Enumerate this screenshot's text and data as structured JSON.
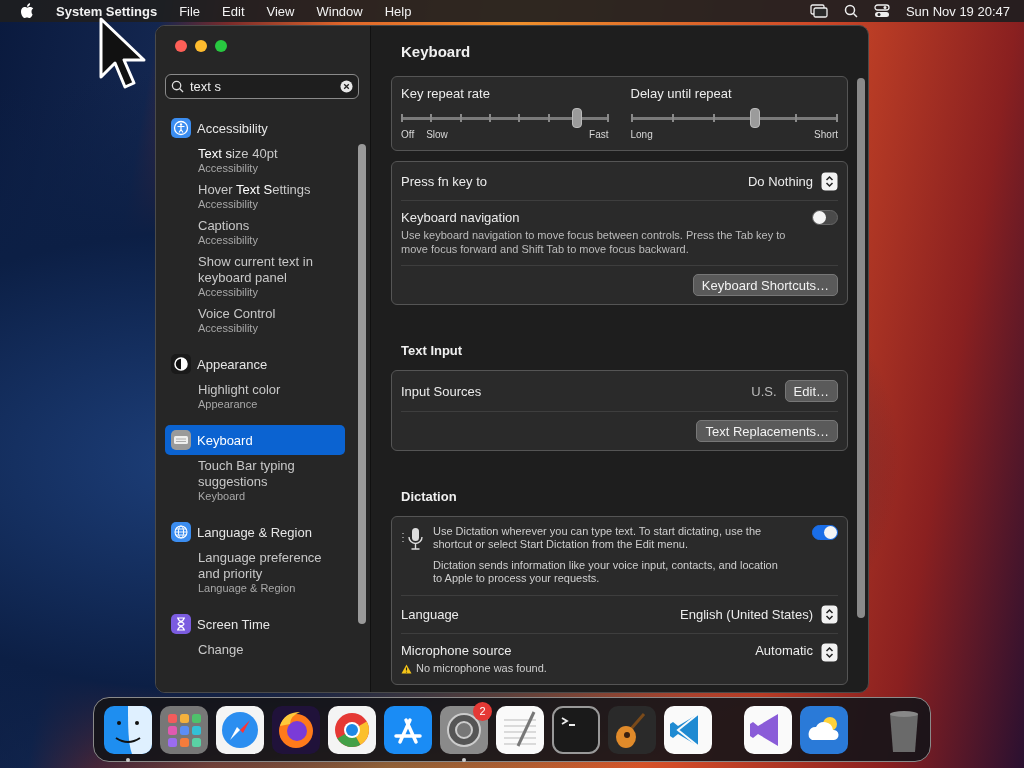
{
  "menu_bar": {
    "app": "System Settings",
    "menus": [
      "File",
      "Edit",
      "View",
      "Window",
      "Help"
    ],
    "clock": "Sun Nov 19  20:47"
  },
  "window": {
    "search": {
      "value": "text s"
    },
    "sidebar": {
      "groups": [
        {
          "kind": "accessibility",
          "label": "Accessibility",
          "color": "#3b8df0",
          "selected": false,
          "results": [
            {
              "title": "**Text s**ize 40pt",
              "subtitle": "Accessibility"
            },
            {
              "title": "Hover **Text S**ettings",
              "subtitle": "Accessibility"
            },
            {
              "title": "Captions",
              "subtitle": "Accessibility"
            },
            {
              "title": "Show current text in keyboard panel",
              "subtitle": "Accessibility"
            },
            {
              "title": "Voice Control",
              "subtitle": "Accessibility"
            }
          ]
        },
        {
          "kind": "appearance",
          "label": "Appearance",
          "color": "#1a1a1a",
          "selected": false,
          "results": [
            {
              "title": "Highlight color",
              "subtitle": "Appearance"
            }
          ]
        },
        {
          "kind": "keyboard",
          "label": "Keyboard",
          "color": "#9a9a9a",
          "selected": true,
          "results": [
            {
              "title": "Touch Bar typing suggestions",
              "subtitle": "Keyboard"
            }
          ]
        },
        {
          "kind": "globe",
          "label": "Language & Region",
          "color": "#3b8df0",
          "selected": false,
          "results": [
            {
              "title": "Language preference and priority",
              "subtitle": "Language & Region"
            }
          ]
        },
        {
          "kind": "hourglass",
          "label": "Screen Time",
          "color": "#7b5ce0",
          "selected": false,
          "results": [
            {
              "title": "Change"
            }
          ]
        }
      ]
    },
    "content": {
      "title": "Keyboard",
      "sections": [
        {
          "cards": [
            {
              "rows": [
                {
                  "kind": "sliders",
                  "sliders": [
                    {
                      "label": "Key repeat rate",
                      "level": 0.85,
                      "scale": [
                        "Off",
                        "Slow",
                        "Fast"
                      ]
                    },
                    {
                      "label": "Delay until repeat",
                      "level": 0.6,
                      "scale": [
                        "Long",
                        "Short"
                      ]
                    }
                  ]
                }
              ]
            },
            {
              "rows": [
                {
                  "kind": "popup",
                  "label": "Press fn key to",
                  "value": "Do Nothing"
                },
                {
                  "kind": "toggle",
                  "label": "Keyboard navigation",
                  "description": "Use keyboard navigation to move focus between controls. Press the Tab key to move focus forward and Shift Tab to move focus backward.",
                  "on": false
                },
                {
                  "kind": "button",
                  "button": "Keyboard Shortcuts…"
                }
              ]
            }
          ]
        },
        {
          "heading": "Text Input",
          "cards": [
            {
              "rows": [
                {
                  "kind": "value_button",
                  "label": "Input Sources",
                  "value": "U.S.",
                  "button": "Edit…"
                },
                {
                  "kind": "button",
                  "button": "Text Replacements…"
                }
              ]
            }
          ]
        },
        {
          "heading": "Dictation",
          "cards": [
            {
              "rows": [
                {
                  "kind": "dictation",
                  "text": "Use Dictation wherever you can type text. To start dictating, use the shortcut or select Start Dictation from the Edit menu.",
                  "note": "Dictation sends information like your voice input, contacts, and location to Apple to process your requests.",
                  "on": true
                },
                {
                  "kind": "popup",
                  "label": "Language",
                  "value": "English (United States)"
                },
                {
                  "kind": "popup",
                  "label": "Microphone source",
                  "value": "Automatic",
                  "warning": "No microphone was found."
                }
              ]
            }
          ]
        }
      ]
    }
  },
  "dock": [
    {
      "kind": "finder",
      "running": true
    },
    {
      "kind": "launchpad",
      "running": false
    },
    {
      "kind": "safari",
      "running": false
    },
    {
      "kind": "firefox",
      "running": false
    },
    {
      "kind": "chrome",
      "running": false
    },
    {
      "kind": "appstore",
      "running": false
    },
    {
      "kind": "settings",
      "running": true,
      "badge": "2"
    },
    {
      "kind": "textedit",
      "running": false
    },
    {
      "kind": "terminal",
      "running": false
    },
    {
      "kind": "guitar",
      "running": false
    },
    {
      "kind": "code",
      "running": false
    },
    {
      "kind": "separator"
    },
    {
      "kind": "vstudio",
      "running": false
    },
    {
      "kind": "weather",
      "running": false
    },
    {
      "kind": "separator"
    },
    {
      "kind": "trash",
      "running": false
    }
  ]
}
